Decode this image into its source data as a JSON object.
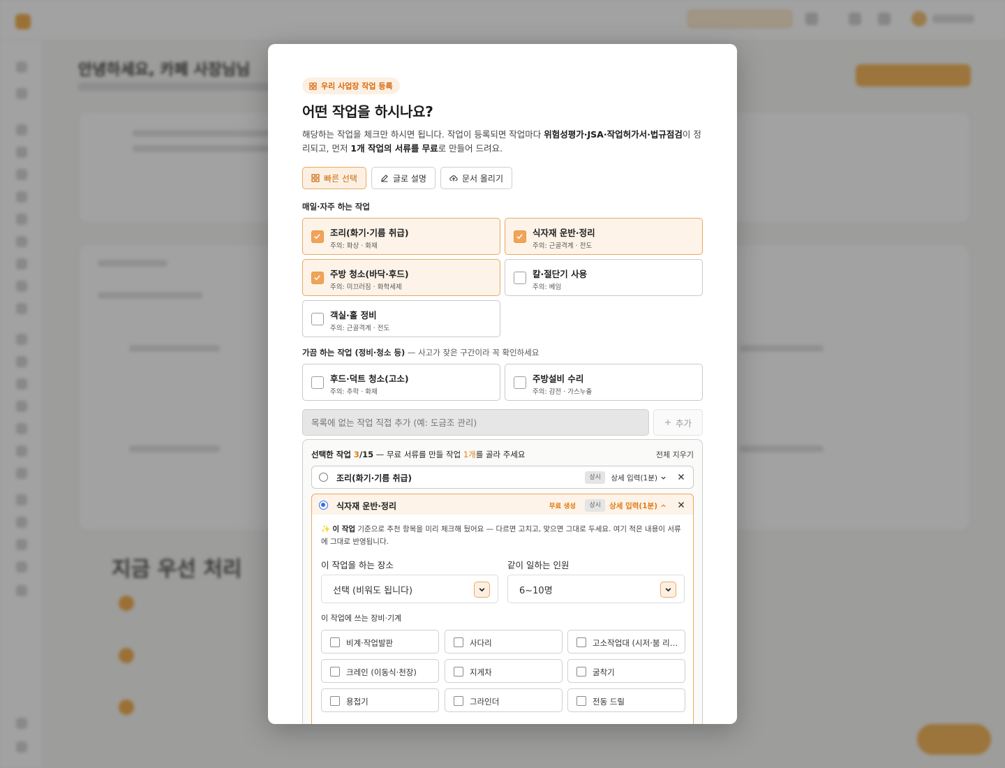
{
  "background": {
    "title": "안녕하세요, 카페 사장님님",
    "section_heading": "지금 우선 처리"
  },
  "modal": {
    "pill": "우리 사업장 작업 등록",
    "title": "어떤 작업을 하시나요?",
    "desc_1": "해당하는 작업을 체크만 하시면 됩니다. 작업이 등록되면 작업마다 ",
    "desc_bold_1": "위험성평가·JSA·작업허가서·법규점검",
    "desc_2": "이 정리되고, 먼저 ",
    "desc_bold_2": "1개 작업의 서류를 무료",
    "desc_3": "로 만들어 드려요.",
    "tabs": [
      {
        "label": "빠른 선택",
        "icon": "grid-icon",
        "active": true
      },
      {
        "label": "글로 설명",
        "icon": "pencil-icon",
        "active": false
      },
      {
        "label": "문서 올리기",
        "icon": "upload-icon",
        "active": false
      }
    ],
    "daily_label": "매일·자주 하는 작업",
    "daily_tasks": [
      {
        "name": "조리(화기·기름 취급)",
        "warn": "주의: 화상 · 화재",
        "checked": true
      },
      {
        "name": "식자재 운반·정리",
        "warn": "주의: 근골격계 · 전도",
        "checked": true
      },
      {
        "name": "주방 청소(바닥·후드)",
        "warn": "주의: 미끄러짐 · 화학세제",
        "checked": true
      },
      {
        "name": "칼·절단기 사용",
        "warn": "주의: 베임",
        "checked": false
      },
      {
        "name": "객실·홀 정비",
        "warn": "주의: 근골격계 · 전도",
        "checked": false
      }
    ],
    "occasional_label": "가끔 하는 작업 (정비·청소 등)",
    "occasional_note": " — 사고가 잦은 구간이라 꼭 확인하세요",
    "occasional_tasks": [
      {
        "name": "후드·덕트 청소(고소)",
        "warn": "주의: 추락 · 화재",
        "checked": false
      },
      {
        "name": "주방설비 수리",
        "warn": "주의: 감전 · 가스누출",
        "checked": false
      }
    ],
    "add_placeholder": "목록에 없는 작업 직접 추가 (예: 도금조 관리)",
    "add_button": "추가",
    "selected": {
      "label": "선택한 작업 ",
      "count": "3",
      "total": "/15",
      "note_1": " — 무료 서류를 만들 작업 ",
      "note_count": "1개",
      "note_2": "를 골라 주세요",
      "clear": "전체 지우기",
      "rows": [
        {
          "name": "조리(화기·기름 취급)",
          "badge": "상시",
          "detail": "상세 입력(1분)",
          "selected": false
        },
        {
          "name": "식자재 운반·정리",
          "free": "무료 생성",
          "badge": "상시",
          "detail": "상세 입력(1분)",
          "selected": true
        }
      ],
      "hint_icon": "✨",
      "hint_bold": "이 작업",
      "hint_text": " 기준으로 추천 항목을 미리 체크해 뒀어요 — 다르면 고치고, 맞으면 그대로 두세요. 여기 적은 내용이 서류에 그대로 반영됩니다.",
      "place_label": "이 작업을 하는 장소",
      "place_value": "선택 (비워도 됩니다)",
      "people_label": "같이 일하는 인원",
      "people_value": "6~10명",
      "equipment_label": "이 작업에 쓰는 장비·기계",
      "equipment": [
        "비계·작업발판",
        "사다리",
        "고소작업대 (시저·붐 리프트)",
        "크레인 (이동식·천장)",
        "지게차",
        "굴착기",
        "용접기",
        "그라인더",
        "전동 드릴"
      ]
    }
  }
}
